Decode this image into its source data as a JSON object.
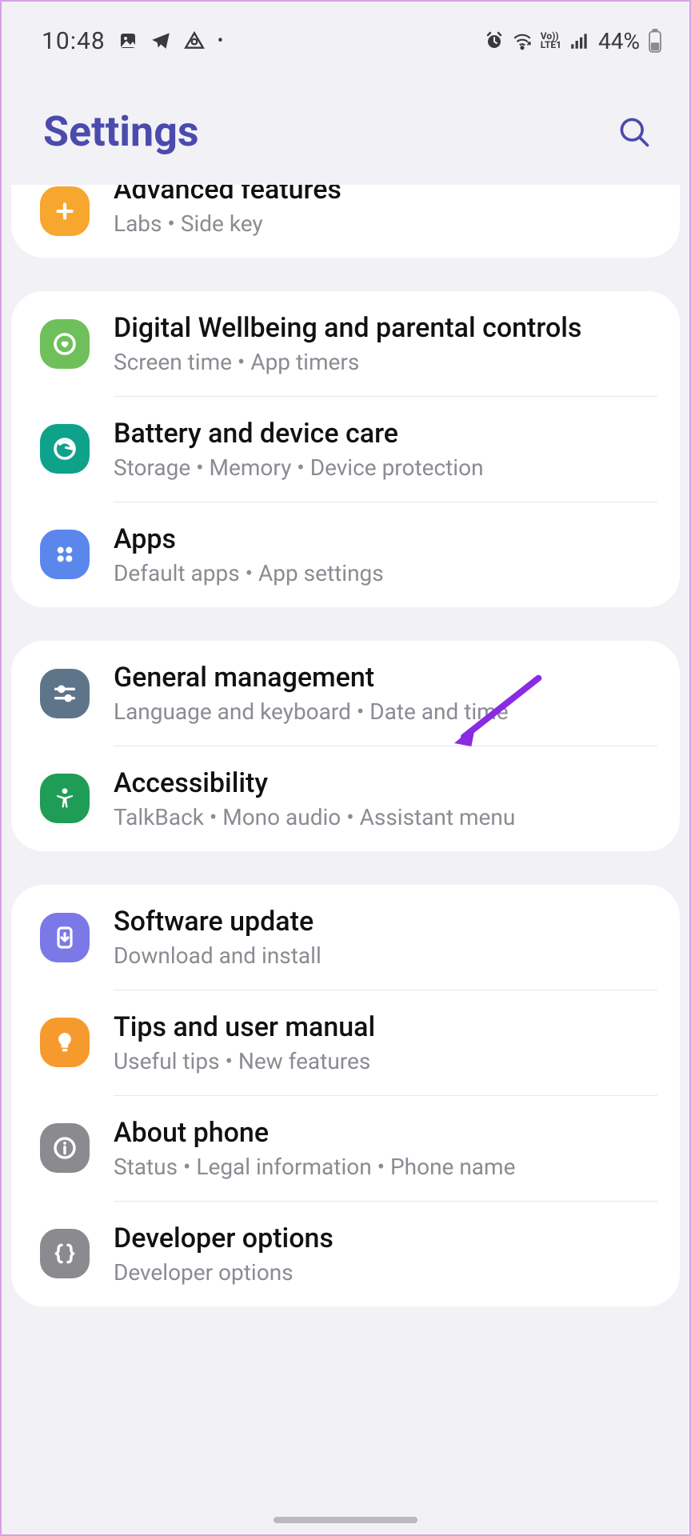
{
  "status": {
    "time": "10:48",
    "battery_pct": "44%"
  },
  "header": {
    "title": "Settings"
  },
  "groups": [
    {
      "rows": [
        {
          "icon": "advanced-features-icon",
          "bg": "bg-orange",
          "title": "Advanced features",
          "sub": "Labs  •  Side key"
        }
      ]
    },
    {
      "rows": [
        {
          "icon": "wellbeing-icon",
          "bg": "bg-green1",
          "title": "Digital Wellbeing and parental controls",
          "sub": "Screen time  •  App timers"
        },
        {
          "icon": "device-care-icon",
          "bg": "bg-teal",
          "title": "Battery and device care",
          "sub": "Storage  •  Memory  •  Device protection"
        },
        {
          "icon": "apps-icon",
          "bg": "bg-blue",
          "title": "Apps",
          "sub": "Default apps  •  App settings"
        }
      ]
    },
    {
      "rows": [
        {
          "icon": "general-management-icon",
          "bg": "bg-slate",
          "title": "General management",
          "sub": "Language and keyboard  •  Date and time"
        },
        {
          "icon": "accessibility-icon",
          "bg": "bg-green2",
          "title": "Accessibility",
          "sub": "TalkBack  •  Mono audio  •  Assistant menu"
        }
      ]
    },
    {
      "rows": [
        {
          "icon": "software-update-icon",
          "bg": "bg-violet",
          "title": "Software update",
          "sub": "Download and install"
        },
        {
          "icon": "tips-icon",
          "bg": "bg-orange2",
          "title": "Tips and user manual",
          "sub": "Useful tips  •  New features"
        },
        {
          "icon": "about-phone-icon",
          "bg": "bg-gray",
          "title": "About phone",
          "sub": "Status  •  Legal information  •  Phone name"
        },
        {
          "icon": "developer-options-icon",
          "bg": "bg-gray2",
          "title": "Developer options",
          "sub": "Developer options"
        }
      ]
    }
  ],
  "icons": {
    "advanced-features-icon": "plus-gear",
    "wellbeing-icon": "heart-circle",
    "device-care-icon": "refresh-circle",
    "apps-icon": "grid-dots",
    "general-management-icon": "sliders",
    "accessibility-icon": "person",
    "software-update-icon": "download-arrow",
    "tips-icon": "bulb",
    "about-phone-icon": "info",
    "developer-options-icon": "braces"
  }
}
